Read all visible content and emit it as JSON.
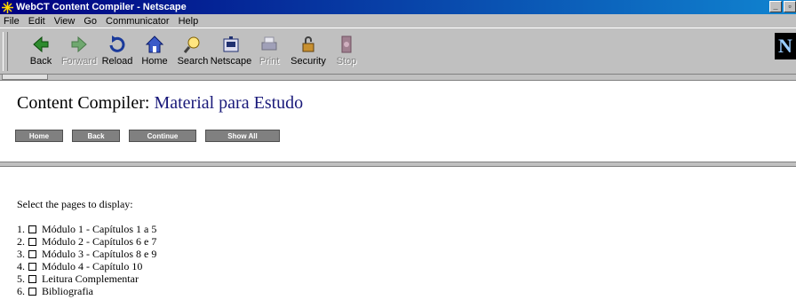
{
  "window": {
    "title": "WebCT Content Compiler - Netscape"
  },
  "menubar": {
    "items": [
      {
        "label": "File"
      },
      {
        "label": "Edit"
      },
      {
        "label": "View"
      },
      {
        "label": "Go"
      },
      {
        "label": "Communicator"
      },
      {
        "label": "Help"
      }
    ]
  },
  "toolbar": {
    "buttons": [
      {
        "label": "Back",
        "icon": "back-arrow-icon",
        "enabled": true
      },
      {
        "label": "Forward",
        "icon": "forward-arrow-icon",
        "enabled": false
      },
      {
        "label": "Reload",
        "icon": "reload-icon",
        "enabled": true
      },
      {
        "label": "Home",
        "icon": "home-icon",
        "enabled": true
      },
      {
        "label": "Search",
        "icon": "search-icon",
        "enabled": true
      },
      {
        "label": "Netscape",
        "icon": "netscape-icon",
        "enabled": true
      },
      {
        "label": "Print",
        "icon": "print-icon",
        "enabled": false
      },
      {
        "label": "Security",
        "icon": "security-lock-icon",
        "enabled": true
      },
      {
        "label": "Stop",
        "icon": "stop-icon",
        "enabled": false
      }
    ],
    "logo": "N"
  },
  "header": {
    "title": "Content Compiler:",
    "subtitle": "Material para Estudo",
    "nav_buttons": [
      {
        "label": "Home"
      },
      {
        "label": "Back"
      },
      {
        "label": "Continue"
      },
      {
        "label": "Show All"
      }
    ]
  },
  "main": {
    "instruction": "Select the pages to display:",
    "pages": [
      {
        "number": "1.",
        "label": "Módulo 1 - Capítulos 1 a 5",
        "checked": false
      },
      {
        "number": "2.",
        "label": "Módulo 2 - Capítulos 6 e 7",
        "checked": false
      },
      {
        "number": "3.",
        "label": "Módulo 3 - Capítulos 8 e 9",
        "checked": false
      },
      {
        "number": "4.",
        "label": "Módulo 4 - Capítulo 10",
        "checked": false
      },
      {
        "number": "5.",
        "label": "Leitura Complementar",
        "checked": false
      },
      {
        "number": "6.",
        "label": "Bibliografia",
        "checked": false
      }
    ]
  },
  "colors": {
    "titlebar": "#000080",
    "chrome": "#c0c0c0",
    "nav_button": "#808080",
    "subtitle": "#1a1a7a"
  }
}
